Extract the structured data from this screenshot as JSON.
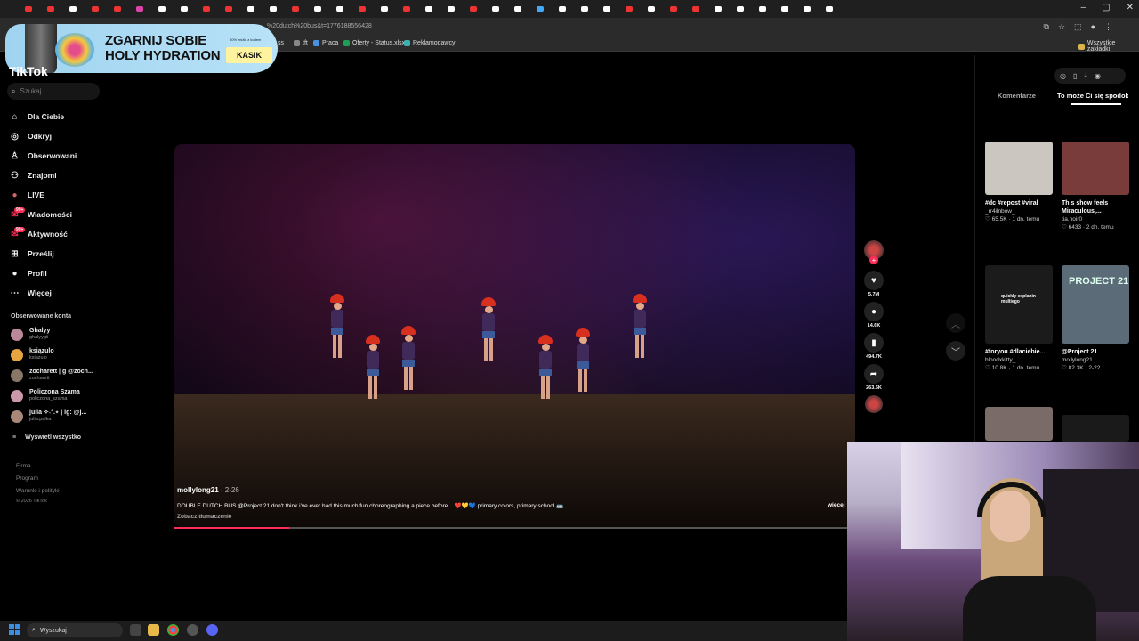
{
  "browser": {
    "url": "%20dutch%20bus&t=1776188556428",
    "bookmarks": [
      "Praca",
      "Oferty - Status.xlsx",
      "Reklamodawcy"
    ],
    "bookmark_short_1": "ss",
    "bookmark_short_2": "tft",
    "all_bookmarks": "Wszystkie zakładki"
  },
  "ad": {
    "title_line1": "ZGARNIJ SOBIE",
    "title_line2": "HOLY HYDRATION",
    "small": "50% zniżki z kodem",
    "code": "KASIK"
  },
  "sidebar": {
    "logo": "TikTok",
    "search_placeholder": "Szukaj",
    "items": [
      {
        "label": "Dla Ciebie",
        "icon": "home-icon"
      },
      {
        "label": "Odkryj",
        "icon": "compass-icon"
      },
      {
        "label": "Obserwowani",
        "icon": "following-icon"
      },
      {
        "label": "Znajomi",
        "icon": "friends-icon"
      },
      {
        "label": "LIVE",
        "icon": "live-icon"
      },
      {
        "label": "Wiadomości",
        "icon": "messages-icon",
        "badge": "99+"
      },
      {
        "label": "Aktywność",
        "icon": "activity-icon",
        "badge": "99+"
      },
      {
        "label": "Prześlij",
        "icon": "upload-icon"
      },
      {
        "label": "Profil",
        "icon": "profile-icon"
      },
      {
        "label": "Więcej",
        "icon": "more-icon"
      }
    ],
    "followed_title": "Obserwowane konta",
    "followed": [
      {
        "name": "Ghalyy",
        "handle": "ghalyygii"
      },
      {
        "name": "ksiązulo",
        "handle": "ksiazulo"
      },
      {
        "name": "zocharett | g @zoch...",
        "handle": "zocharett"
      },
      {
        "name": "Policzona Szama",
        "handle": "policzona_szama"
      },
      {
        "name": "julia ✧˖°.⋆ | ig: @j...",
        "handle": "julia.palka"
      }
    ],
    "show_all": "Wyświetl wszystko",
    "footer": [
      "Firma",
      "Program",
      "Warunki i polityki",
      "© 2026 TikTok"
    ]
  },
  "video": {
    "author": "mollylong21",
    "date": " · 2-26",
    "caption": "DOUBLE DUTCH BUS @Project 21 don't think i've ever had this much fun choreographing a piece before... ❤️💛💙 primary colors, primary school 🚌",
    "translate": "Zobacz tłumaczenie",
    "more": "więcej",
    "progress": 0.17
  },
  "actions": [
    {
      "name": "like",
      "icon": "heart-icon",
      "glyph": "♥",
      "value": "5.7M"
    },
    {
      "name": "comment",
      "icon": "comment-icon",
      "glyph": "●",
      "value": "14.6K"
    },
    {
      "name": "save",
      "icon": "bookmark-icon",
      "glyph": "▮",
      "value": "494.7K"
    },
    {
      "name": "share",
      "icon": "share-icon",
      "glyph": "➦",
      "value": "263.6K"
    }
  ],
  "right_panel": {
    "tab_comments": "Komentarze",
    "tab_suggested": "To może Ci się spodobać",
    "cards": [
      {
        "title": "#dc #repost #viral",
        "user": "_rr4ilnbow_",
        "meta": "♡ 65.5K · 1 dn. temu",
        "color": "#ccc6c0"
      },
      {
        "title": "This show feels Miraculous,...",
        "user": "tia.noir0",
        "meta": "♡ 6433 · 2 dn. temu",
        "color": "#7a3b3b"
      },
      {
        "title": "#foryou #dlaciebie...",
        "user": "bloodxkitty_",
        "meta": "♡ 10.8K · 1 dn. temu",
        "color": "#1b1b1b",
        "overlay": "quickly explanin multiego"
      },
      {
        "title": "@Project 21",
        "user": "mollylong21",
        "meta": "♡ 82.3K · 2-22",
        "color": "#5c6b78",
        "overlay": "PROJECT 21"
      }
    ]
  },
  "taskbar": {
    "search_placeholder": "Wyszukaj"
  },
  "colors": {
    "accent": "#fe2c55",
    "background": "#000000"
  }
}
